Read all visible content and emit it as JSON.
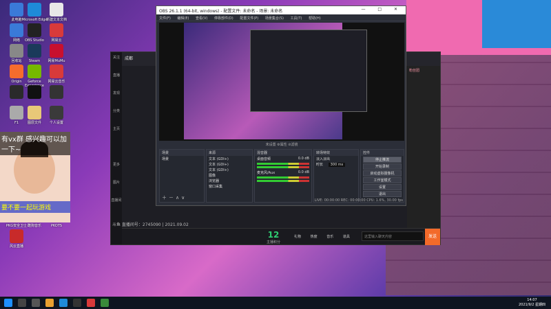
{
  "desktop": {
    "icons": [
      {
        "label": "此电脑",
        "color": "#3a7ad8"
      },
      {
        "label": "Microsoft Edge",
        "color": "#1e8ad8"
      },
      {
        "label": "新建文本文档",
        "color": "#e8e8e8"
      },
      {
        "label": "网络",
        "color": "#3a7ad8"
      },
      {
        "label": "OBS Studio",
        "color": "#222"
      },
      {
        "label": "网易云",
        "color": "#d83a3a"
      },
      {
        "label": "回收站",
        "color": "#888"
      },
      {
        "label": "Steam",
        "color": "#1a3a5a"
      },
      {
        "label": "网易MuMu",
        "color": "#c8102e"
      },
      {
        "label": "Origin",
        "color": "#f56c2d"
      },
      {
        "label": "Geforce Experience",
        "color": "#76b900"
      },
      {
        "label": "网易云音乐",
        "color": "#d83a3a"
      },
      {
        "label": "",
        "color": "#2a2a2a"
      },
      {
        "label": "",
        "color": "#111"
      },
      {
        "label": "",
        "color": "#333"
      },
      {
        "label": "F1",
        "color": "#aaa"
      },
      {
        "label": "图层文件",
        "color": "#e8c878"
      },
      {
        "label": "个人设置",
        "color": "#3a3a3a"
      },
      {
        "label": "PKG安全卫士",
        "color": "#2ecc71"
      },
      {
        "label": "酷狗音乐",
        "color": "#1e7ae8"
      },
      {
        "label": "PKOTS",
        "color": "#444"
      },
      {
        "label": "风云直播",
        "color": "#c82a2a"
      }
    ]
  },
  "overlay": {
    "top_text": "有vx群  感兴趣可以加一下~",
    "bottom_text": "要不要一起玩游戏"
  },
  "app": {
    "title": "成都",
    "side_items": [
      "关注",
      "直播",
      "发现",
      "分类",
      "主页",
      "",
      "更多",
      "图片",
      "直播间"
    ],
    "live_id": "斗鱼 直播间号：2745090 | 2021.09.02",
    "viewers": "12",
    "viewers_label": "主播积分",
    "footer_tools": [
      "礼物",
      "热度",
      "音乐",
      "道具"
    ],
    "chat_placeholder": "这里输入聊天内容",
    "send_label": "发送",
    "right_label": "粉丝团"
  },
  "obs": {
    "title": "OBS 26.1.1 (64-bit, windows) - 配置文件: 未命名 - 场景: 未命名",
    "menu": [
      "文件(F)",
      "编辑(E)",
      "查看(V)",
      "停靠部件(D)",
      "配置文件(P)",
      "场景集合(S)",
      "工具(T)",
      "帮助(H)"
    ],
    "window_controls": "— □ ✕",
    "tabs": "未设置   ⚙属性   ⊘滤镜",
    "scenes": {
      "header": "场景",
      "items": [
        "场景"
      ]
    },
    "sources": {
      "header": "来源",
      "items": [
        "文本 (GDI+)",
        "文本 (GDI+)",
        "文本 (GDI+)",
        "图像",
        "浏览器",
        "窗口采集"
      ]
    },
    "mixer": {
      "header": "混音器",
      "channels": [
        {
          "name": "桌面音频",
          "db": "0.0 dB"
        },
        {
          "name": "麦克风/Aux",
          "db": "0.0 dB"
        }
      ]
    },
    "transitions": {
      "header": "转场特效",
      "type": "淡入淡出",
      "duration_label": "时长",
      "duration": "300 ms"
    },
    "controls": {
      "header": "控件",
      "buttons": [
        "停止推流",
        "开始录制",
        "启动虚拟摄像机",
        "工作室模式",
        "设置",
        "退出"
      ]
    },
    "status": "LIVE: 00:00:00   REC: 00:00:00   CPU: 1.6%, 30.00 fps"
  },
  "taskbar": {
    "time": "14:07",
    "date": "2021/9/2 星期四"
  }
}
